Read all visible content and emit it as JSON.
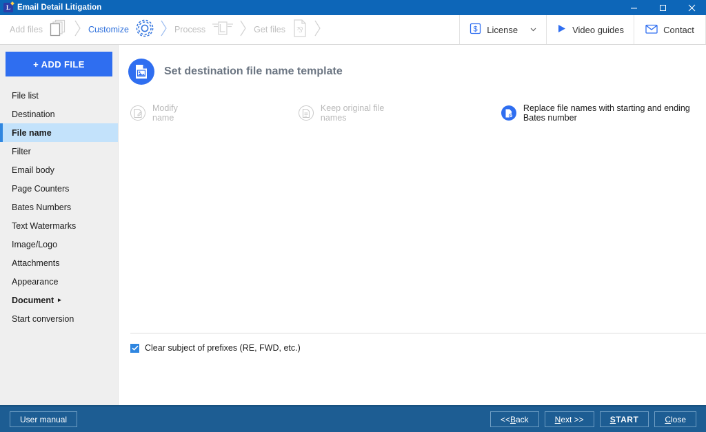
{
  "window": {
    "title": "Email Detail Litigation",
    "app_icon": "app-logo-icon",
    "minimize": "minimize-icon",
    "maximize": "maximize-icon",
    "close": "close-icon",
    "titlebar_color": "#0d66b8"
  },
  "wizard": {
    "steps": [
      {
        "label": "Add files",
        "icon": "stacked-papers-icon",
        "active": false
      },
      {
        "label": "Customize",
        "icon": "gear-icon",
        "active": true
      },
      {
        "label": "Process",
        "icon": "process-winged-l-icon",
        "active": false
      },
      {
        "label": "Get files",
        "icon": "pdf-file-icon",
        "active": false
      }
    ],
    "separator": "❯",
    "active_color": "#2a6ddb",
    "inactive_color": "#bfbfbf"
  },
  "topbar": {
    "license": {
      "label": "License",
      "icon": "dollar-badge-icon",
      "caret": "⌄"
    },
    "video_guides": {
      "label": "Video guides",
      "icon": "play-triangle-icon"
    },
    "contact": {
      "label": "Contact",
      "icon": "envelope-icon"
    }
  },
  "sidebar": {
    "add_file_label": "+ ADD FILE",
    "add_file_color": "#2f6ef0",
    "selected_color": "#c3e2fb",
    "items": [
      {
        "label": "File list",
        "selected": false,
        "bold": false,
        "submenu": false
      },
      {
        "label": "Destination",
        "selected": false,
        "bold": false,
        "submenu": false
      },
      {
        "label": "File name",
        "selected": true,
        "bold": true,
        "submenu": false
      },
      {
        "label": "Filter",
        "selected": false,
        "bold": false,
        "submenu": false
      },
      {
        "label": "Email body",
        "selected": false,
        "bold": false,
        "submenu": false
      },
      {
        "label": "Page Counters",
        "selected": false,
        "bold": false,
        "submenu": false
      },
      {
        "label": "Bates Numbers",
        "selected": false,
        "bold": false,
        "submenu": false
      },
      {
        "label": "Text Watermarks",
        "selected": false,
        "bold": false,
        "submenu": false
      },
      {
        "label": "Image/Logo",
        "selected": false,
        "bold": false,
        "submenu": false
      },
      {
        "label": "Attachments",
        "selected": false,
        "bold": false,
        "submenu": false
      },
      {
        "label": "Appearance",
        "selected": false,
        "bold": false,
        "submenu": false
      },
      {
        "label": "Document",
        "selected": false,
        "bold": true,
        "submenu": true,
        "arrow": "▸"
      },
      {
        "label": "Start conversion",
        "selected": false,
        "bold": false,
        "submenu": false
      }
    ]
  },
  "panel": {
    "icon": "document-image-icon",
    "title": "Set destination file name template",
    "options": [
      {
        "label": "Modify name",
        "icon": "document-edit-icon",
        "selected": false
      },
      {
        "label": "Keep original file names",
        "icon": "document-plain-icon",
        "selected": false
      },
      {
        "label": "Replace file names with starting and ending Bates number",
        "icon": "document-gear-icon",
        "selected": true
      }
    ],
    "checkbox": {
      "label": "Clear subject of prefixes (RE, FWD, etc.)",
      "checked": true,
      "check_glyph": "✓"
    }
  },
  "footer": {
    "user_manual": "User manual",
    "back": "<< Back",
    "next": "Next >>",
    "start": "START",
    "close": "Close",
    "bar_color": "#1d5d93"
  }
}
